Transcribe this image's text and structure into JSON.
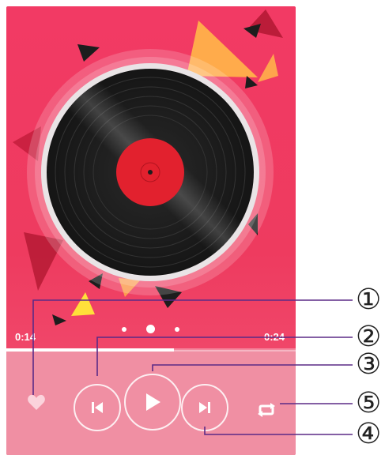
{
  "player": {
    "elapsed_time": "0:14",
    "total_time": "0:24",
    "progress": 0.58,
    "page_count": 3,
    "active_page": 2
  },
  "controls": {
    "favorite_icon": "heart-icon",
    "previous_icon": "skip-previous-icon",
    "play_icon": "play-icon",
    "next_icon": "skip-next-icon",
    "repeat_icon": "repeat-icon"
  },
  "callouts": [
    "①",
    "②",
    "③",
    "④",
    "⑤"
  ],
  "colors": {
    "background": "#f23a64",
    "panel": "#f08fa3",
    "callout_line": "#5b2a86",
    "record_label": "#e2212e"
  }
}
